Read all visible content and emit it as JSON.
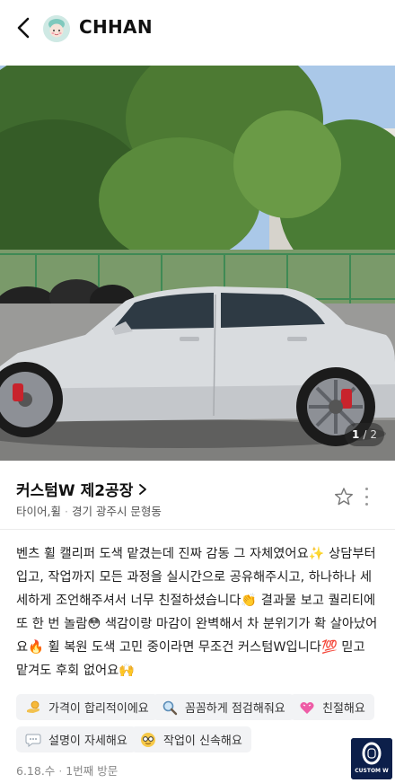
{
  "header": {
    "username": "CHHAN"
  },
  "photo": {
    "current_index": "1",
    "separator": "/",
    "total": "2"
  },
  "place": {
    "name": "커스텀W 제2공장",
    "category": "타이어,휠",
    "separator": "·",
    "address": "경기 광주시 문형동"
  },
  "review": {
    "text": "벤츠 휠 캘리퍼 도색 맡겼는데 진짜 감동 그 자체였어요✨ 상담부터 입고, 작업까지 모든 과정을 실시간으로 공유해주시고, 하나하나 세세하게 조언해주셔서 너무 친절하셨습니다👏 결과물 보고 퀄리티에 또 한 번 놀람😳 색감이랑 마감이 완벽해서 차 분위기가 확 살아났어요🔥 휠 복원 도색 고민 중이라면 무조건 커스텀W입니다💯 믿고 맡겨도 후회 없어요🙌"
  },
  "tags": [
    {
      "label": "가격이 합리적이에요",
      "icon": "coin-hand-icon"
    },
    {
      "label": "꼼꼼하게 점검해줘요",
      "icon": "magnifier-icon"
    },
    {
      "label": "친절해요",
      "icon": "heart-icon"
    },
    {
      "label": "설명이 자세해요",
      "icon": "speech-bubble-icon"
    },
    {
      "label": "작업이 신속해요",
      "icon": "glasses-face-icon"
    }
  ],
  "visit": {
    "date": "6.18.수",
    "separator": "·",
    "count": "1번째 방문"
  },
  "logo": {
    "text": "CUSTOM W"
  },
  "colors": {
    "logo_bg": "#0c1f4a",
    "tag_bg": "#f2f3f5",
    "caliper_red": "#c8232c"
  }
}
